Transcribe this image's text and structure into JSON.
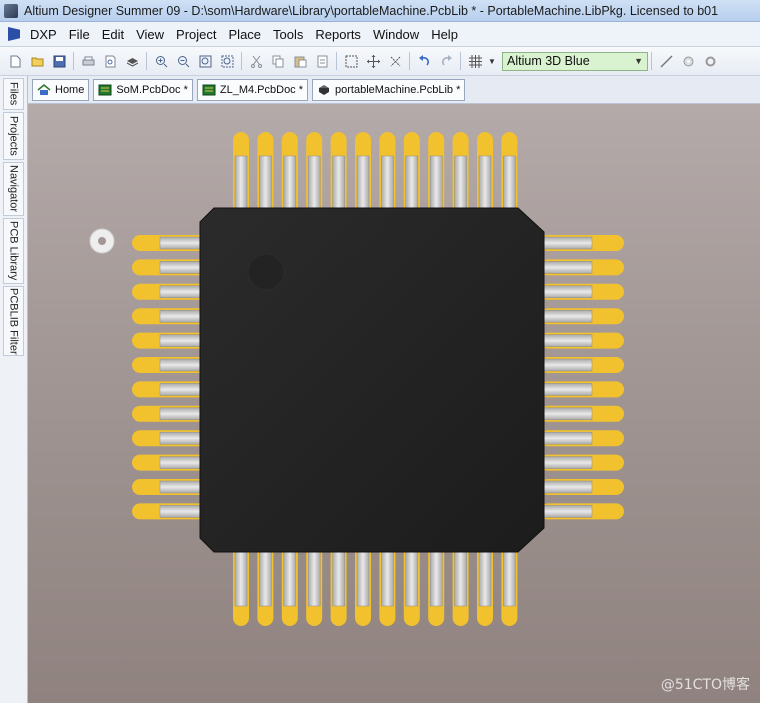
{
  "window": {
    "title": "Altium Designer Summer 09 - D:\\som\\Hardware\\Library\\portableMachine.PcbLib * - PortableMachine.LibPkg. Licensed to b01"
  },
  "menu": {
    "dxp": "DXP",
    "items": [
      "File",
      "Edit",
      "View",
      "Project",
      "Place",
      "Tools",
      "Reports",
      "Window",
      "Help"
    ]
  },
  "toolbar": {
    "view_config_value": "Altium 3D Blue",
    "icons": [
      "new-icon",
      "open-icon",
      "save-icon",
      "print-icon",
      "print-preview-icon",
      "layer-stack-icon",
      "zoom-in-icon",
      "zoom-out-icon",
      "zoom-fit-icon",
      "zoom-selected-icon",
      "cut-icon",
      "copy-icon",
      "paste-icon",
      "rubber-stamp-icon",
      "select-area-icon",
      "move-icon",
      "deselect-icon",
      "undo-icon",
      "redo-icon",
      "grid-icon",
      "line-icon",
      "pad-icon",
      "via-icon"
    ]
  },
  "side_tabs": [
    "Files",
    "Projects",
    "Navigator",
    "PCB Library",
    "PCBLIB Filter"
  ],
  "doc_tabs": [
    {
      "label": "Home",
      "icon": "home-icon"
    },
    {
      "label": "SoM.PcbDoc *",
      "icon": "pcb-doc-icon"
    },
    {
      "label": "ZL_M4.PcbDoc *",
      "icon": "pcb-doc-icon"
    },
    {
      "label": "portableMachine.PcbLib *",
      "icon": "pcb-lib-icon"
    }
  ],
  "component": {
    "package": "QFP",
    "pins_per_side": 12,
    "colors": {
      "body": "#252525",
      "pad": "#f2c12e",
      "lead": "#cfcfcf",
      "board_top": "#b4aaa9",
      "board_bottom": "#8f827f"
    }
  },
  "watermark": "@51CTO博客"
}
